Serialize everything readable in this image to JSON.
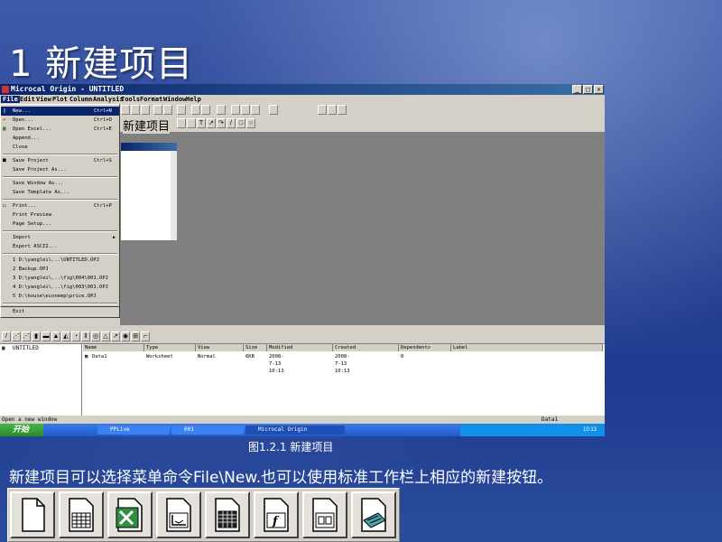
{
  "slide": {
    "title": "1 新建项目",
    "caption": "图1.2.1 新建项目",
    "description": "新建项目可以选择菜单命令File\\New.也可以使用标准工作栏上相应的新建按钮。"
  },
  "window": {
    "title": "Microcal Origin - UNTITLED",
    "controls": {
      "minimize": "_",
      "maximize": "□",
      "close": "✕"
    },
    "overlay_label": "新建项目"
  },
  "menubar": {
    "items": [
      "File",
      "Edit",
      "View",
      "Plot",
      "Column",
      "Analysis",
      "Tools",
      "Format",
      "Window",
      "Help"
    ]
  },
  "file_menu": {
    "items": [
      {
        "label": "New...",
        "shortcut": "Ctrl+N",
        "icon": "new-doc-icon",
        "highlighted": true
      },
      {
        "label": "Open...",
        "shortcut": "Ctrl+O",
        "icon": "open-folder-icon"
      },
      {
        "label": "Open Excel...",
        "shortcut": "Ctrl+E",
        "icon": "excel-icon"
      },
      {
        "label": "Append...",
        "shortcut": ""
      },
      {
        "label": "Close",
        "shortcut": ""
      },
      {
        "label": "Save Project",
        "shortcut": "Ctrl+S",
        "icon": "save-icon"
      },
      {
        "label": "Save Project As...",
        "shortcut": ""
      },
      {
        "label": "Save Window As...",
        "shortcut": ""
      },
      {
        "label": "Save Template As...",
        "shortcut": ""
      },
      {
        "label": "Print...",
        "shortcut": "Ctrl+P",
        "icon": "print-icon"
      },
      {
        "label": "Print Preview",
        "shortcut": ""
      },
      {
        "label": "Page Setup...",
        "shortcut": ""
      },
      {
        "label": "Import",
        "shortcut": "",
        "submenu": true
      },
      {
        "label": "Export ASCII...",
        "shortcut": ""
      },
      {
        "label": "1 D:\\yanglei\\...\\UNTITLED.OPJ",
        "shortcut": ""
      },
      {
        "label": "2 Backup.OPJ",
        "shortcut": ""
      },
      {
        "label": "3 D:\\yanglei\\...\\fig\\004\\001.OPJ",
        "shortcut": ""
      },
      {
        "label": "4 D:\\yanglei\\...\\fig\\003\\001.OPJ",
        "shortcut": ""
      },
      {
        "label": "5 D:\\house\\econemp\\price.OPJ",
        "shortcut": ""
      },
      {
        "label": "Exit",
        "shortcut": ""
      }
    ]
  },
  "explorer": {
    "tree_root": "UNTITLED",
    "columns": [
      "Name",
      "Type",
      "View",
      "Size",
      "Modified",
      "Created",
      "Dependents",
      "Label"
    ],
    "rows": [
      {
        "Name": "Data1",
        "Type": "Worksheet",
        "View": "Normal",
        "Size": "6KB",
        "Modified": "2008-7-13 10:13",
        "Created": "2008-7-13 10:13",
        "Dependents": "0",
        "Label": ""
      }
    ]
  },
  "status_bar": {
    "text": "Open a new window",
    "right": "Data1"
  },
  "taskbar": {
    "start_label": "开始",
    "tasks": [
      {
        "label": "PPLive",
        "active": false
      },
      {
        "label": "001",
        "active": false
      },
      {
        "label": "Microcal Origin",
        "active": true
      }
    ],
    "clock": "10:13"
  },
  "colors": {
    "slide_background": "#2a4494",
    "titlebar": "#0a246a",
    "window_face": "#d4d0c8",
    "workspace": "#808080"
  }
}
